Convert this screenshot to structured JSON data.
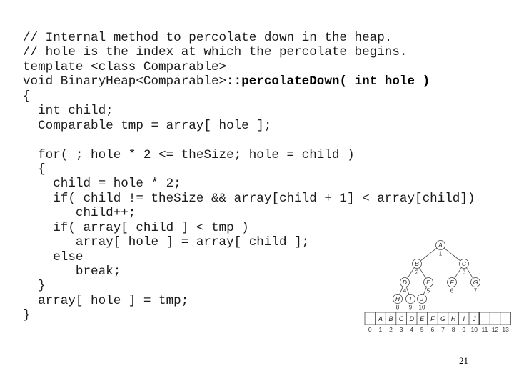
{
  "code": {
    "lines": [
      {
        "pre": "// Internal method to percolate down in the heap.",
        "bold": "",
        "post": ""
      },
      {
        "pre": "// hole is the index at which the percolate begins.",
        "bold": "",
        "post": ""
      },
      {
        "pre": "template <class Comparable>",
        "bold": "",
        "post": ""
      },
      {
        "pre": "void BinaryHeap<Comparable>",
        "bold": "::percolateDown( int hole )",
        "post": ""
      },
      {
        "pre": "{",
        "bold": "",
        "post": ""
      },
      {
        "pre": "  int child;",
        "bold": "",
        "post": ""
      },
      {
        "pre": "  Comparable tmp = array[ hole ];",
        "bold": "",
        "post": ""
      },
      {
        "pre": "",
        "bold": "",
        "post": ""
      },
      {
        "pre": "  for( ; hole * 2 <= theSize; hole = child )",
        "bold": "",
        "post": ""
      },
      {
        "pre": "  {",
        "bold": "",
        "post": ""
      },
      {
        "pre": "    child = hole * 2;",
        "bold": "",
        "post": ""
      },
      {
        "pre": "    if( child != theSize && array[child + 1] < array[child])",
        "bold": "",
        "post": ""
      },
      {
        "pre": "       child++;",
        "bold": "",
        "post": ""
      },
      {
        "pre": "    if( array[ child ] < tmp )",
        "bold": "",
        "post": ""
      },
      {
        "pre": "       array[ hole ] = array[ child ];",
        "bold": "",
        "post": ""
      },
      {
        "pre": "    else",
        "bold": "",
        "post": ""
      },
      {
        "pre": "       break;",
        "bold": "",
        "post": ""
      },
      {
        "pre": "  }",
        "bold": "",
        "post": ""
      },
      {
        "pre": "  array[ hole ] = tmp;",
        "bold": "",
        "post": ""
      },
      {
        "pre": "}",
        "bold": "",
        "post": ""
      }
    ]
  },
  "heap_figure": {
    "nodes": [
      {
        "label": "A",
        "index": "1"
      },
      {
        "label": "B",
        "index": "2"
      },
      {
        "label": "C",
        "index": "3"
      },
      {
        "label": "D",
        "index": "4"
      },
      {
        "label": "E",
        "index": "5"
      },
      {
        "label": "F",
        "index": "6"
      },
      {
        "label": "G",
        "index": "7"
      },
      {
        "label": "H",
        "index": "8"
      },
      {
        "label": "I",
        "index": "9"
      },
      {
        "label": "J",
        "index": "10"
      }
    ],
    "array_cells": [
      "",
      "A",
      "B",
      "C",
      "D",
      "E",
      "F",
      "G",
      "H",
      "I",
      "J",
      "",
      "",
      ""
    ],
    "array_indices": [
      "0",
      "1",
      "2",
      "3",
      "4",
      "5",
      "6",
      "7",
      "8",
      "9",
      "10",
      "11",
      "12",
      "13"
    ]
  },
  "page_number": "21"
}
